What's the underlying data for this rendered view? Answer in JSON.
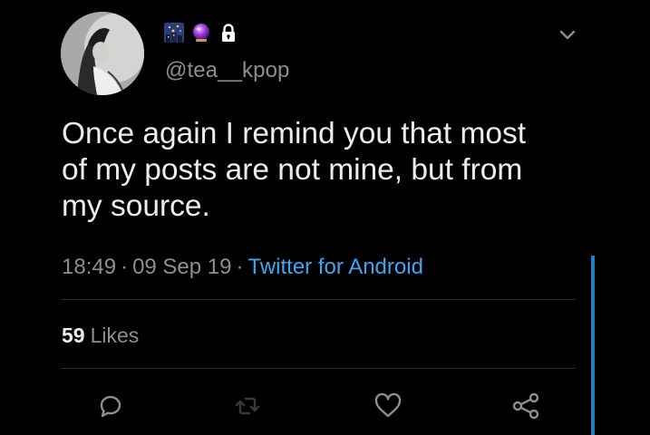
{
  "user": {
    "handle": "@tea__kpop",
    "name_icons": [
      "night-city-emoji-icon",
      "crystal-ball-emoji-icon",
      "lock-icon"
    ]
  },
  "tweet": {
    "text": "Once again I remind you that most\nof my posts are not mine, but from\nmy source.",
    "time": "18:49",
    "date": "09 Sep 19",
    "separator": "·",
    "source": "Twitter for Android"
  },
  "stats": {
    "likes_count": "59",
    "likes_label": "Likes"
  },
  "actions": [
    "reply-icon",
    "retweet-icon",
    "like-icon",
    "share-icon"
  ],
  "colors": {
    "background": "#000000",
    "text": "#ececec",
    "secondary": "#8e8e8e",
    "accent": "#3ea6f0"
  }
}
